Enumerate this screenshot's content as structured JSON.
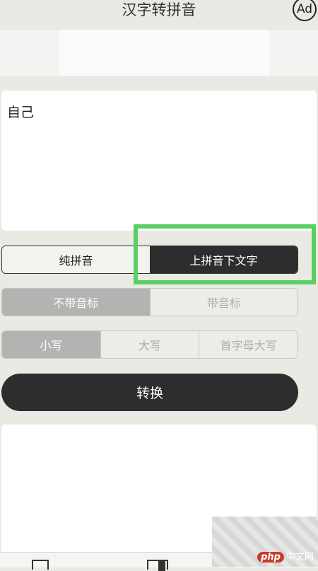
{
  "header": {
    "title": "汉字转拼音",
    "ad_label": "Ad"
  },
  "input": {
    "text": "自己"
  },
  "mode": {
    "options": [
      "纯拼音",
      "上拼音下文字"
    ],
    "selected": "上拼音下文字"
  },
  "tone": {
    "options": [
      "不带音标",
      "带音标"
    ],
    "selected": "不带音标"
  },
  "case": {
    "options": [
      "小写",
      "大写",
      "首字母大写"
    ],
    "selected": "小写"
  },
  "convert_label": "转换",
  "watermark": {
    "badge": "php",
    "text": "中文网"
  },
  "colors": {
    "highlight": "#58d063",
    "dark": "#2d2d2d",
    "selected_grey": "#b3b3b1"
  }
}
